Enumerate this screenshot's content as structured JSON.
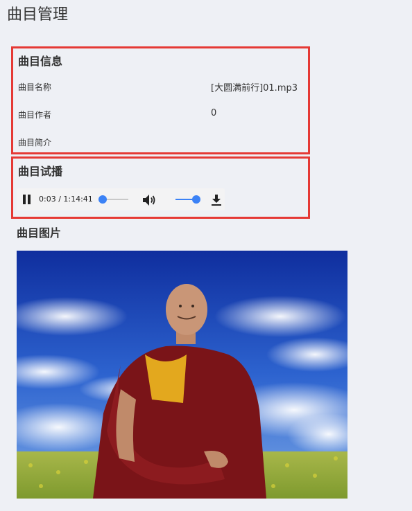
{
  "page": {
    "title": "曲目管理"
  },
  "info": {
    "section_title": "曲目信息",
    "rows": [
      {
        "label": "曲目名称",
        "value": "[大圆满前行]01.mp3"
      },
      {
        "label": "曲目作者",
        "value": "0"
      },
      {
        "label": "曲目简介",
        "value": ""
      }
    ]
  },
  "preview": {
    "section_title": "曲目试播",
    "player": {
      "time_text": "0:03 / 1:14:41",
      "progress_fraction": 0.0007,
      "volume_fraction": 1.0,
      "icons": [
        "pause-icon",
        "volume-icon",
        "download-icon"
      ],
      "accent_color": "#3b82f6"
    }
  },
  "picture": {
    "section_title": "曲目图片"
  },
  "colors": {
    "highlight_border": "#e53935",
    "background": "#eef0f5"
  }
}
